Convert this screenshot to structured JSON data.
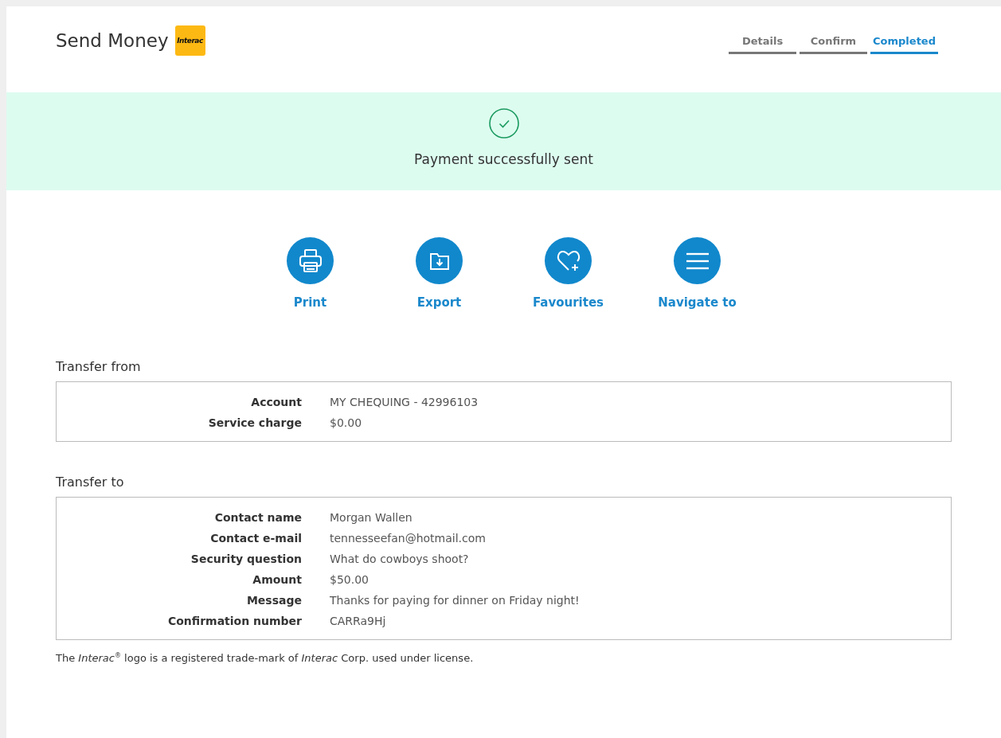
{
  "header": {
    "title": "Send Money",
    "logo_text": "Interac"
  },
  "steps": [
    {
      "label": "Details",
      "selected": false
    },
    {
      "label": "Confirm",
      "selected": false
    },
    {
      "label": "Completed",
      "selected": true
    }
  ],
  "banner": {
    "message": "Payment successfully sent"
  },
  "actions": [
    {
      "kind": "print",
      "label": "Print"
    },
    {
      "kind": "export",
      "label": "Export"
    },
    {
      "kind": "favourite",
      "label": "Favourites"
    },
    {
      "kind": "menu",
      "label": "Navigate to"
    }
  ],
  "sections": [
    {
      "title": "Transfer from",
      "rows": [
        {
          "label": "Account",
          "value": "MY CHEQUING - 42996103"
        },
        {
          "label": "Service charge",
          "value": "$0.00"
        }
      ]
    },
    {
      "title": "Transfer to",
      "rows": [
        {
          "label": "Contact name",
          "value": "Morgan Wallen"
        },
        {
          "label": "Contact e-mail",
          "value": "tennesseefan@hotmail.com"
        },
        {
          "label": "Security question",
          "value": "What do cowboys shoot?"
        },
        {
          "label": "Amount",
          "value": "$50.00"
        },
        {
          "label": "Message",
          "value": "Thanks for paying for dinner on Friday night!"
        },
        {
          "label": "Confirmation number",
          "value": "CARRa9Hj"
        }
      ]
    }
  ],
  "footnote": "The *Interac*$^{®}$ logo is a registered trade-mark of *Interac* Corp. used under license."
}
